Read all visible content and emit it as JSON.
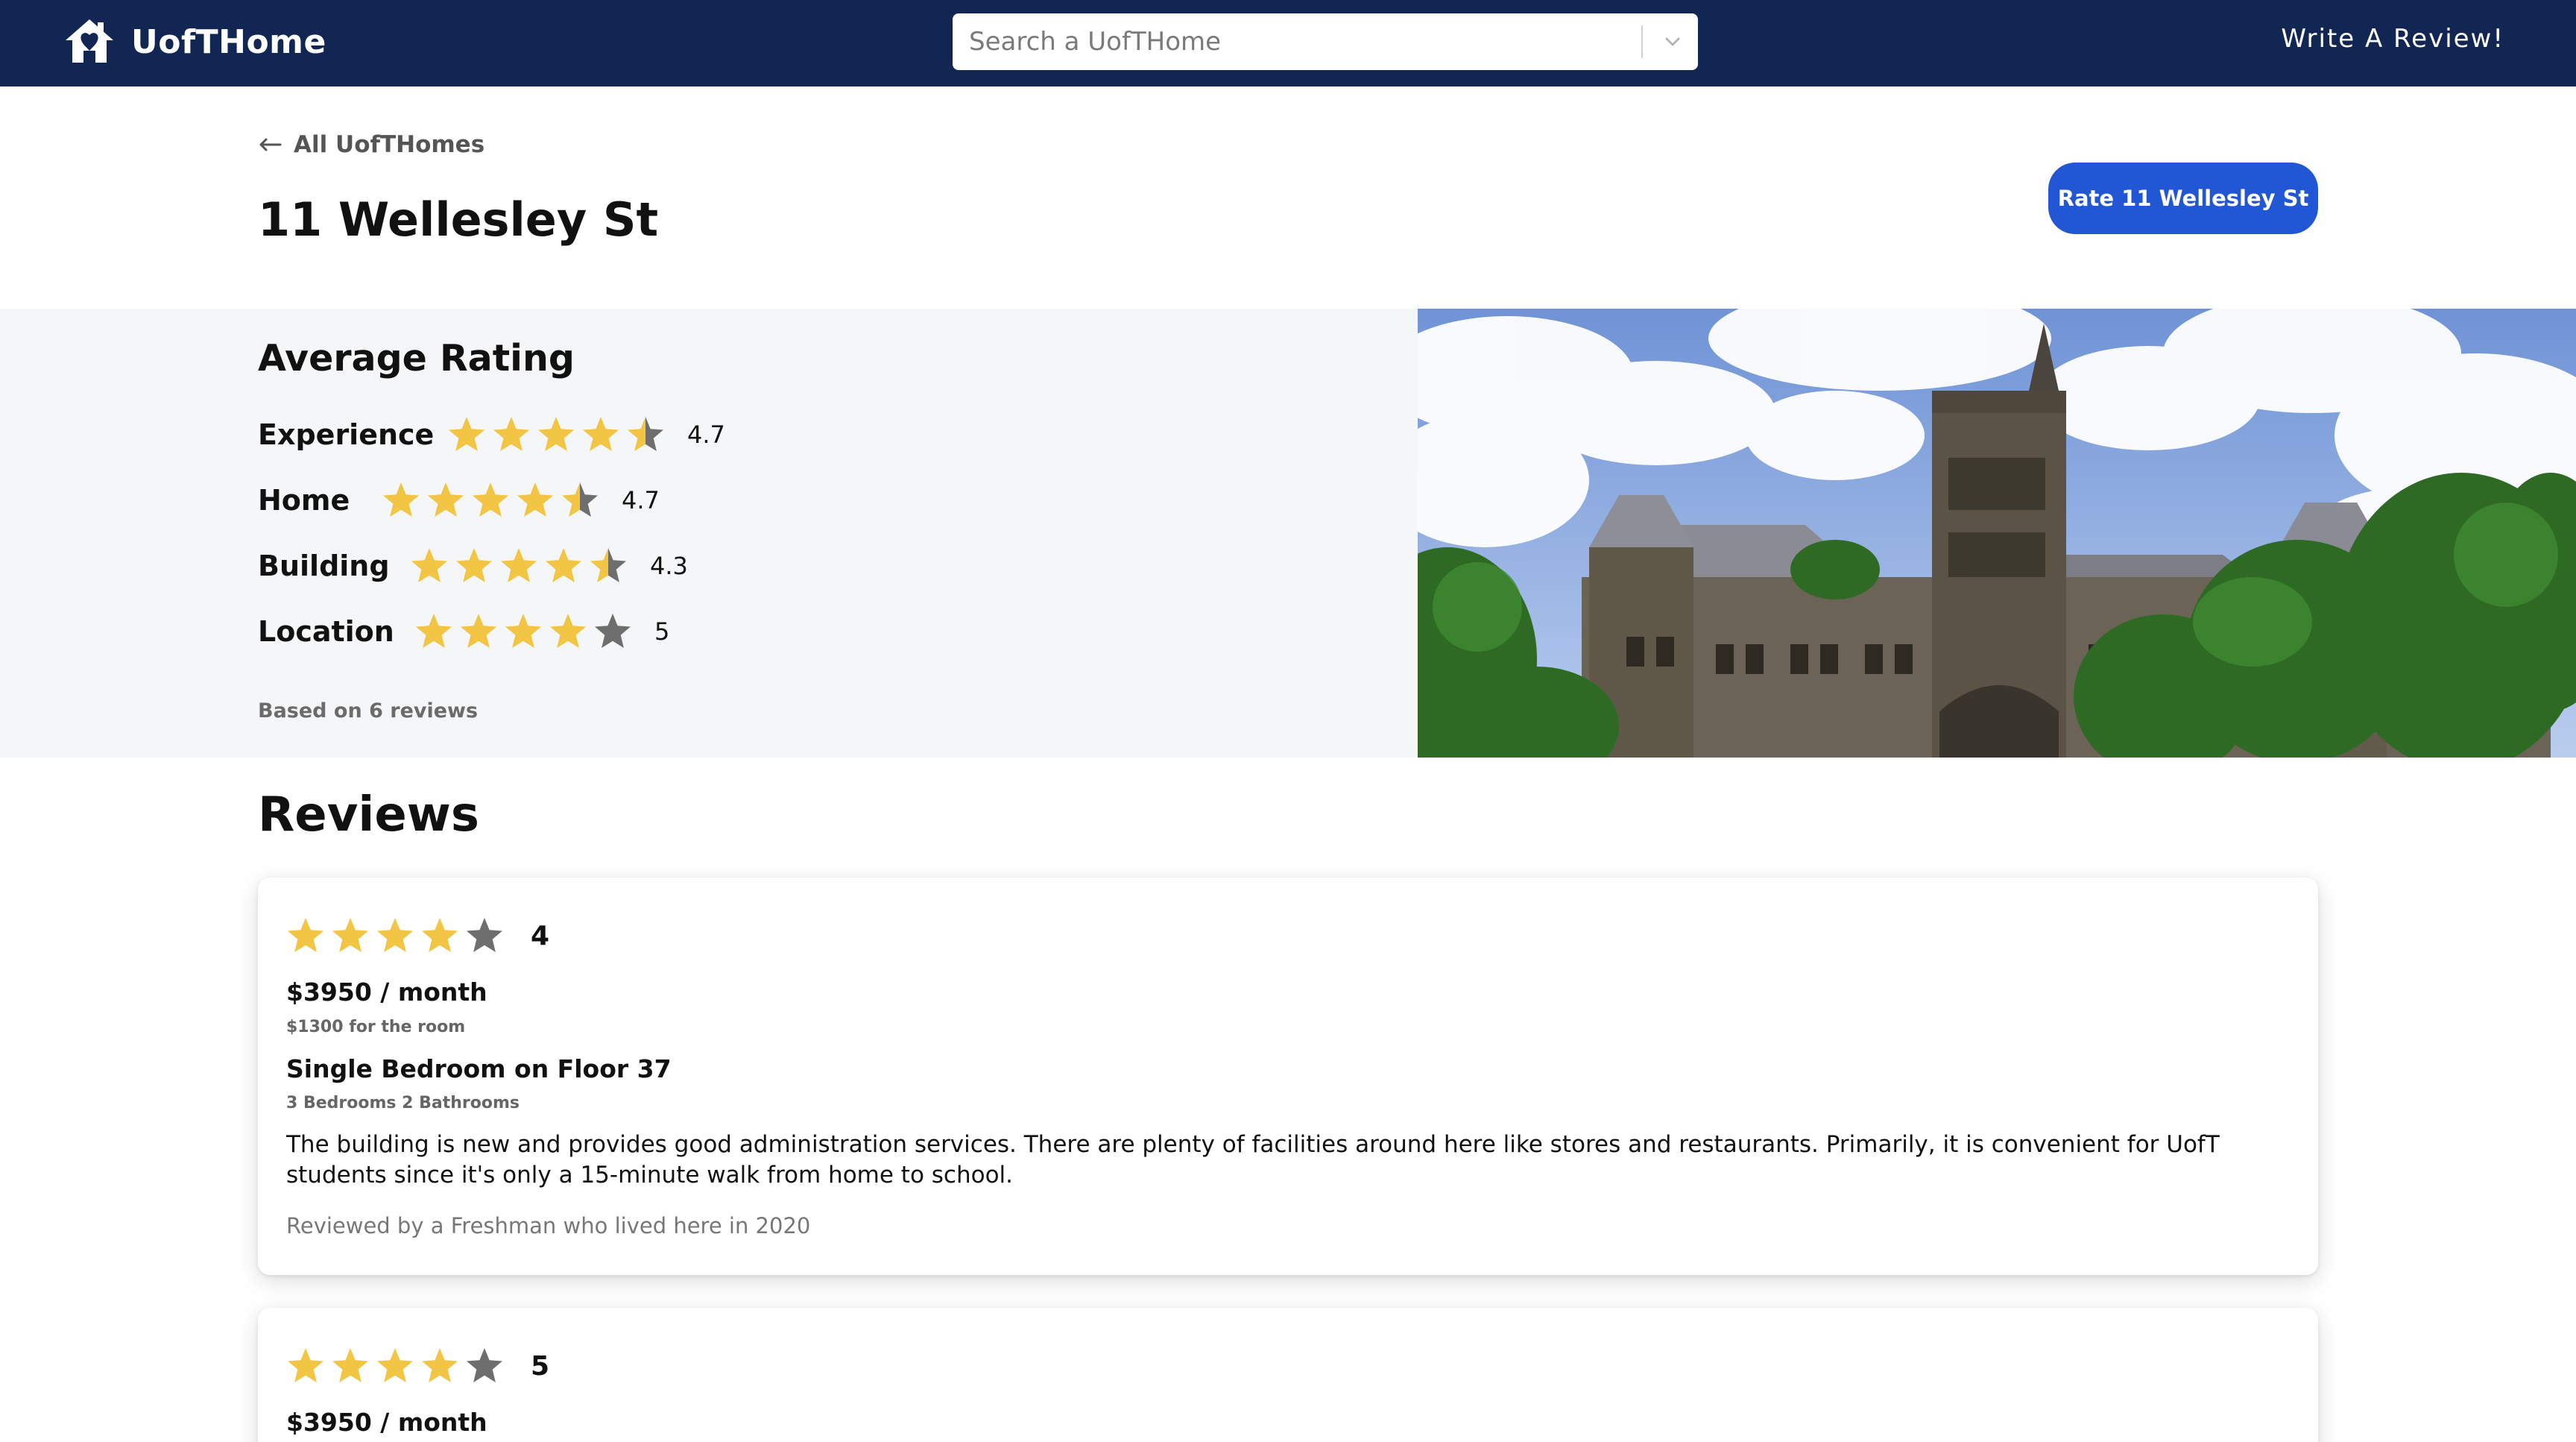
{
  "nav": {
    "brand": "UofTHome",
    "search_placeholder": "Search a UofTHome",
    "write_review": "Write A Review!"
  },
  "header": {
    "back_label": "All UofTHomes",
    "title": "11 Wellesley St",
    "rate_button": "Rate 11 Wellesley St"
  },
  "ratings": {
    "title": "Average Rating",
    "items": [
      {
        "label": "Experience",
        "value": "4.7",
        "stars": 4.5
      },
      {
        "label": "Home",
        "value": "4.7",
        "stars": 4.5
      },
      {
        "label": "Building",
        "value": "4.3",
        "stars": 4.5
      },
      {
        "label": "Location",
        "value": "5",
        "stars": 4
      }
    ],
    "based_on": "Based on 6 reviews"
  },
  "reviews": {
    "title": "Reviews",
    "items": [
      {
        "score": "4",
        "stars": 4,
        "price": "$3950 / month",
        "price_note": "$1300 for the room",
        "room": "Single Bedroom on Floor 37",
        "layout": "3 Bedrooms 2 Bathrooms",
        "text": "The building is new and provides good administration services. There are plenty of facilities around here like stores and restaurants. Primarily, it is convenient for UofT students since it's only a 15-minute walk from home to school.",
        "reviewer": "Reviewed by a Freshman who lived here in 2020"
      },
      {
        "score": "5",
        "stars": 4,
        "price": "$3950 / month"
      }
    ]
  },
  "colors": {
    "nav_bg": "#112653",
    "accent_button": "#2156d4",
    "star_filled": "#f2c544",
    "star_empty": "#6e6e6e",
    "panel_bg": "#f5f6f8"
  },
  "icons": {
    "brand": "house-icon",
    "back": "arrow-left-icon",
    "search_caret": "chevron-down-icon",
    "star": "star-icon"
  }
}
